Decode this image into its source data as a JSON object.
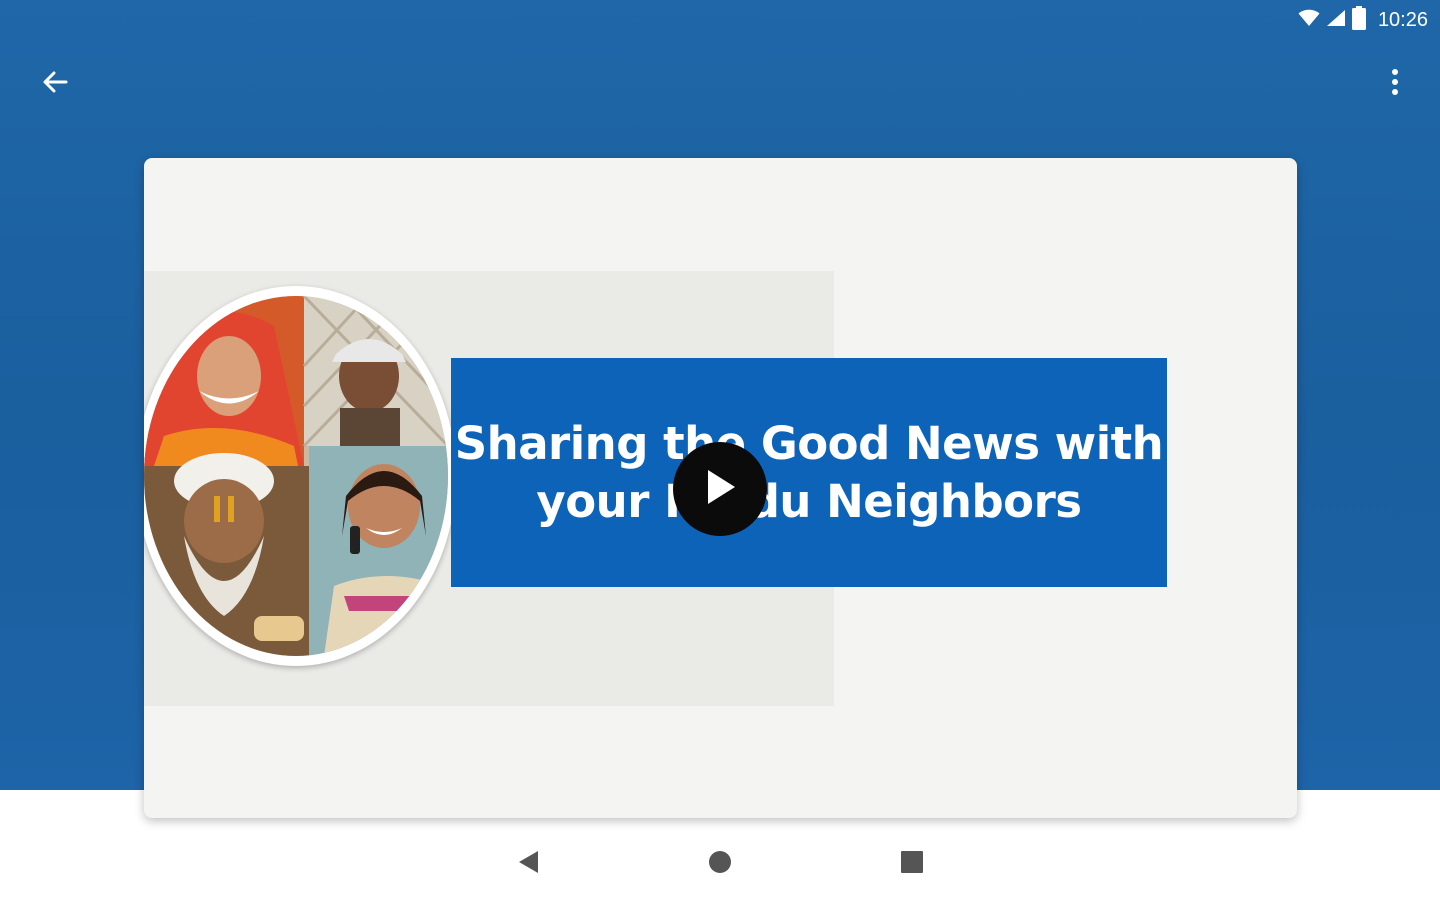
{
  "status_bar": {
    "time": "10:26",
    "icons": [
      "wifi-icon",
      "cell-signal-icon",
      "battery-icon"
    ]
  },
  "toolbar": {
    "back_icon": "arrow-back-icon",
    "menu_icon": "more-vert-icon"
  },
  "video": {
    "title_line1": "Sharing the Good News with",
    "title_line2": "your Hindu Neighbors",
    "play_icon": "play-icon",
    "banner_color": "#0d63b8"
  },
  "nav_bar": {
    "icons": [
      "nav-back-icon",
      "nav-home-icon",
      "nav-recents-icon"
    ]
  },
  "colors": {
    "header": "#1a5f9e",
    "card": "#f4f4f2"
  }
}
